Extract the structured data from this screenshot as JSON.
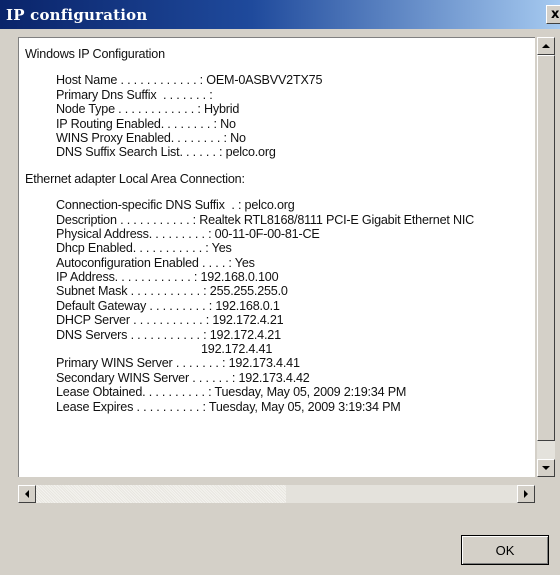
{
  "window": {
    "title": "IP configuration",
    "close_label": "x"
  },
  "content": {
    "header": "Windows IP Configuration",
    "host_section": [
      "Host Name . . . . . . . . . . . . : OEM-0ASBVV2TX75",
      "Primary Dns Suffix  . . . . . . . :",
      "Node Type . . . . . . . . . . . . : Hybrid",
      "IP Routing Enabled. . . . . . . . : No",
      "WINS Proxy Enabled. . . . . . . . : No",
      "DNS Suffix Search List. . . . . . : pelco.org"
    ],
    "adapter_header": "Ethernet adapter Local Area Connection:",
    "adapter_section": [
      "Connection-specific DNS Suffix  . : pelco.org",
      "Description . . . . . . . . . . . : Realtek RTL8168/8111 PCI-E Gigabit Ethernet NIC",
      "Physical Address. . . . . . . . . : 00-11-0F-00-81-CE",
      "Dhcp Enabled. . . . . . . . . . . : Yes",
      "Autoconfiguration Enabled . . . . : Yes",
      "IP Address. . . . . . . . . . . . : 192.168.0.100",
      "Subnet Mask . . . . . . . . . . . : 255.255.255.0",
      "Default Gateway . . . . . . . . . : 192.168.0.1",
      "DHCP Server . . . . . . . . . . . : 192.172.4.21",
      "DNS Servers . . . . . . . . . . . : 192.172.4.21"
    ],
    "dns_secondary": "192.172.4.41",
    "adapter_section_tail": [
      "Primary WINS Server . . . . . . . : 192.173.4.41",
      "Secondary WINS Server . . . . . . : 192.173.4.42",
      "Lease Obtained. . . . . . . . . . : Tuesday, May 05, 2009 2:19:34 PM",
      "Lease Expires . . . . . . . . . . : Tuesday, May 05, 2009 3:19:34 PM"
    ]
  },
  "buttons": {
    "ok_label": "OK"
  },
  "icons": {
    "scroll_up": "arrow-up-icon",
    "scroll_down": "arrow-down-icon",
    "scroll_left": "arrow-left-icon",
    "scroll_right": "arrow-right-icon"
  },
  "colors": {
    "titlebar_start": "#0a246a",
    "titlebar_end": "#a6caf0",
    "dialog_bg": "#d4d0c8"
  }
}
